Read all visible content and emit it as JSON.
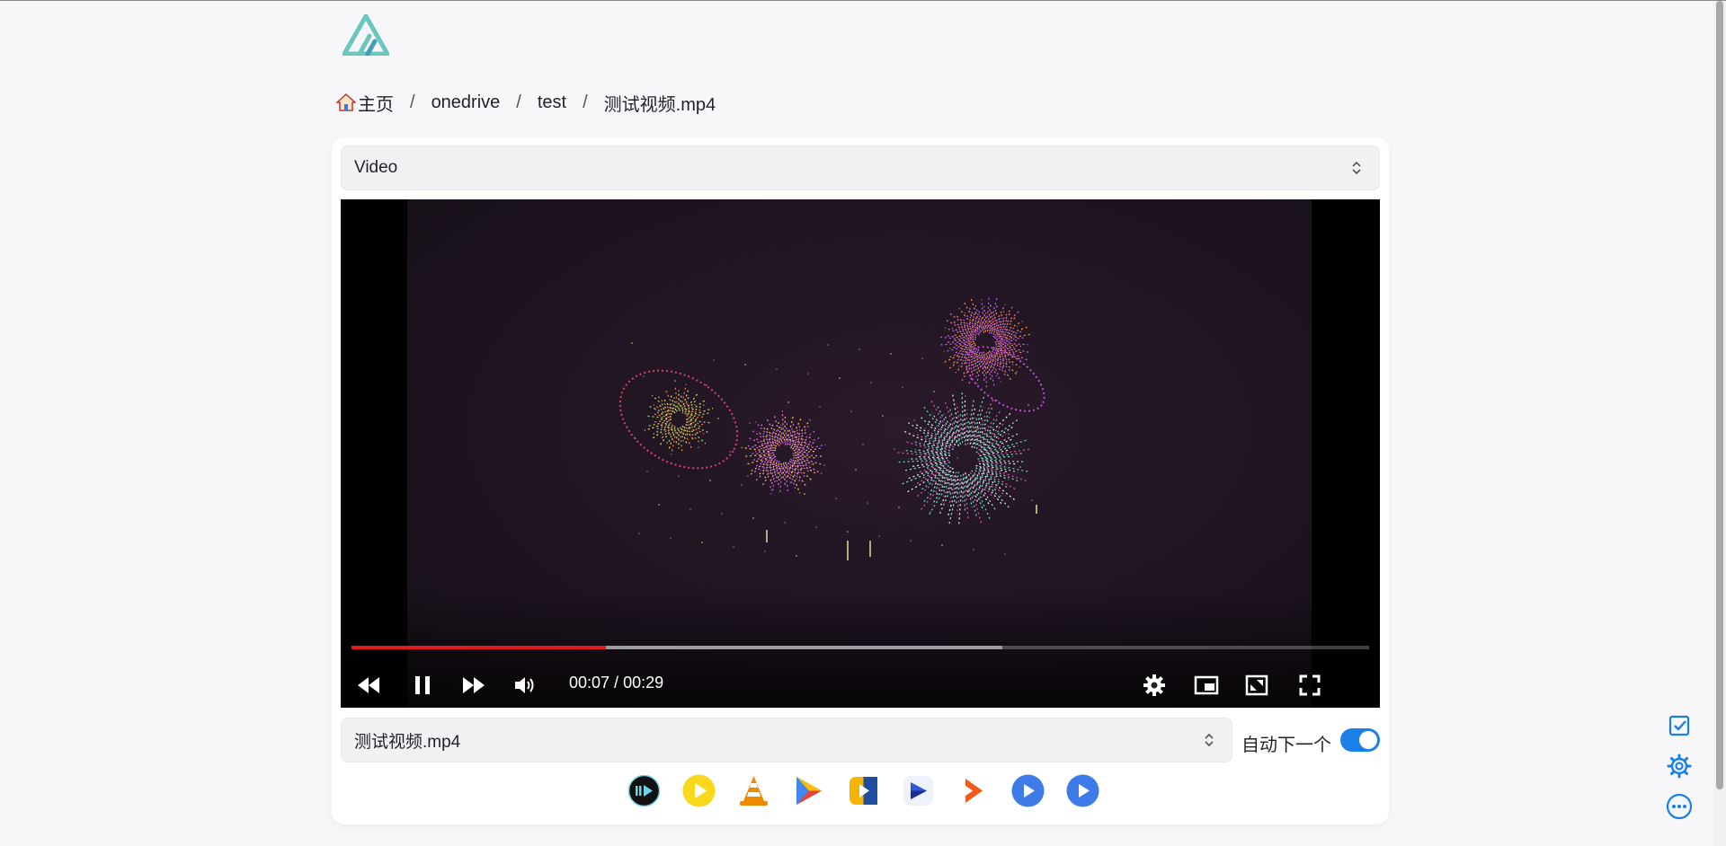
{
  "breadcrumb": {
    "home": "主页",
    "items": [
      "onedrive",
      "test",
      "测试视频.mp4"
    ],
    "separator": "/"
  },
  "preview_select": {
    "value": "Video"
  },
  "player": {
    "current_time": "00:07",
    "duration": "00:29",
    "time_separator": " / ",
    "played_fraction": 0.25,
    "buffered_fraction": 0.64,
    "accent_color": "#e01b1b"
  },
  "file_select": {
    "value": "测试视频.mp4"
  },
  "autonext": {
    "label": "自动下一个",
    "enabled": true,
    "color": "#1a7fe8"
  },
  "external_players": [
    "iina-icon",
    "potplayer-icon",
    "vlc-icon",
    "nplayer-icon",
    "omniplayer-icon",
    "figplayer-icon",
    "infuse-icon",
    "mx-player-icon",
    "mx-player-pro-icon"
  ],
  "side_actions": [
    "checkbox-icon",
    "gear-icon",
    "more-icon"
  ]
}
